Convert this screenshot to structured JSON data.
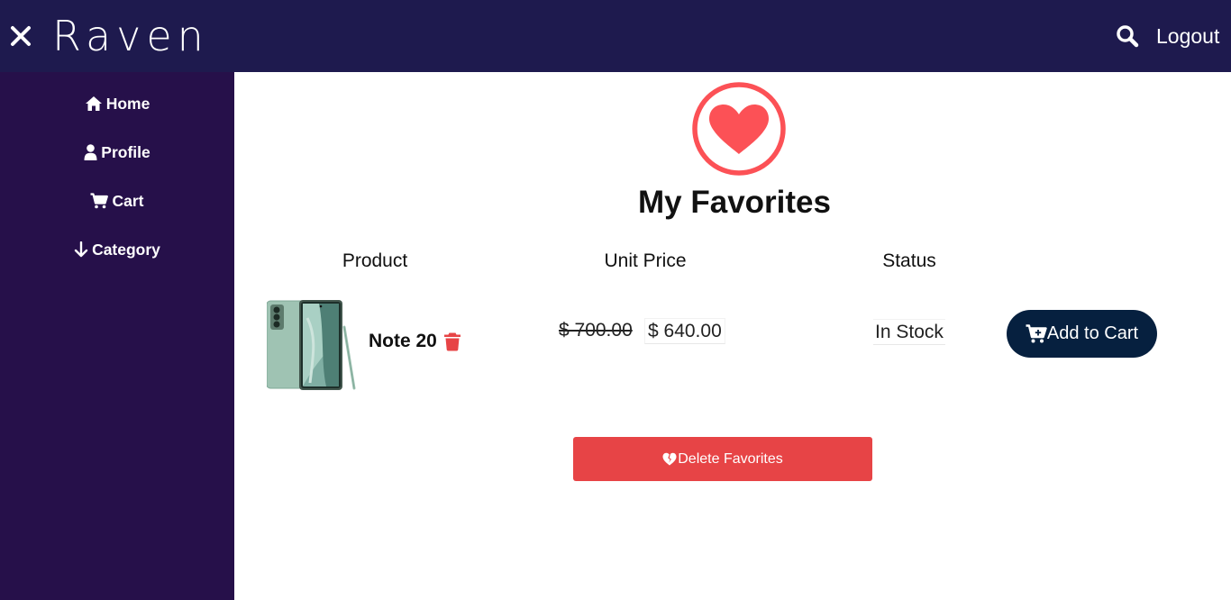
{
  "header": {
    "brand": "Raven",
    "logout_label": "Logout",
    "background": "#1e1a4e"
  },
  "sidebar": {
    "background": "#26104a",
    "items": [
      {
        "label": "Home",
        "icon": "home-icon"
      },
      {
        "label": "Profile",
        "icon": "user-icon"
      },
      {
        "label": "Cart",
        "icon": "cart-icon"
      },
      {
        "label": "Category",
        "icon": "arrow-down-icon"
      }
    ]
  },
  "main": {
    "title": "My Favorites",
    "title_icon": "heart-icon",
    "accent_color": "#fc5156",
    "columns": [
      "Product",
      "Unit Price",
      "Status"
    ],
    "items": [
      {
        "name": "Note 20",
        "old_price": "$ 700.00",
        "price": "$ 640.00",
        "status": "In Stock",
        "action_label": "Add to Cart"
      }
    ],
    "delete_label": "Delete Favorites"
  },
  "colors": {
    "add_to_cart": "#06203f",
    "delete": "#e74446",
    "trash": "#e74446"
  }
}
